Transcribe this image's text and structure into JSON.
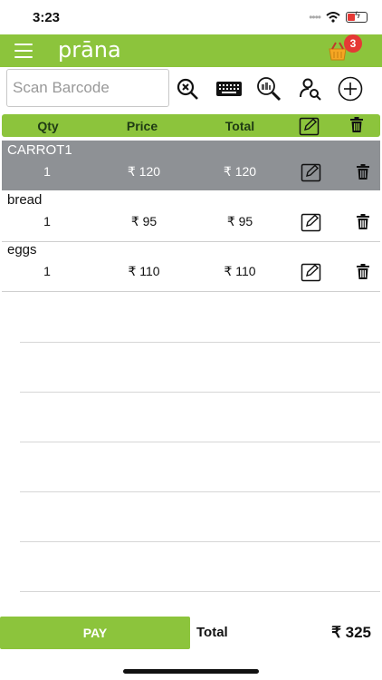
{
  "status": {
    "time": "3:23"
  },
  "app": {
    "title": "prāna",
    "cart_count": "3"
  },
  "search": {
    "placeholder": "Scan Barcode"
  },
  "table": {
    "headers": {
      "qty": "Qty",
      "price": "Price",
      "total": "Total"
    },
    "items": [
      {
        "name": "CARROT1",
        "qty": "1",
        "price": "₹ 120",
        "total": "₹ 120"
      },
      {
        "name": "bread",
        "qty": "1",
        "price": "₹ 95",
        "total": "₹ 95"
      },
      {
        "name": "eggs",
        "qty": "1",
        "price": "₹ 110",
        "total": "₹ 110"
      }
    ]
  },
  "footer": {
    "pay_label": "PAY",
    "total_label": "Total",
    "total_value": "₹ 325"
  },
  "colors": {
    "brand": "#8cc43c",
    "selected_row": "#8e9195",
    "badge": "#e53935"
  }
}
